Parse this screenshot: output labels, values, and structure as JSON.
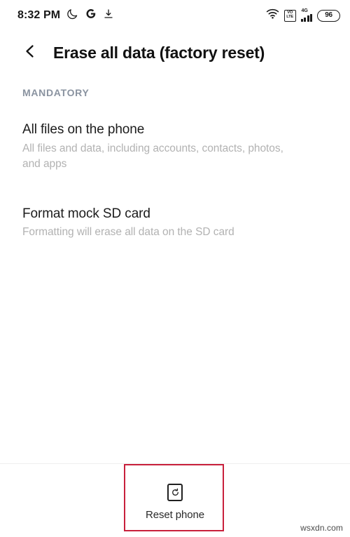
{
  "status_bar": {
    "time": "8:32 PM",
    "icons_left": [
      "moon-icon",
      "google-icon",
      "download-icon"
    ],
    "volte_line1": "VO",
    "volte_line2": "LTE",
    "network_type": "4G",
    "battery_level": "96",
    "icons_right": [
      "wifi-icon",
      "volte-icon",
      "signal-icon",
      "battery-icon"
    ]
  },
  "app_bar": {
    "back_icon": "chevron-left-icon",
    "title": "Erase all data (factory reset)"
  },
  "content": {
    "section_header": "MANDATORY",
    "items": [
      {
        "title": "All files on the phone",
        "subtitle": "All files and data, including accounts, contacts, photos, and apps"
      },
      {
        "title": "Format mock SD card",
        "subtitle": "Formatting will erase all data on the SD card"
      }
    ]
  },
  "bottom_bar": {
    "reset_icon": "reset-phone-icon",
    "reset_label": "Reset phone"
  },
  "annotation": {
    "color": "#c8203c"
  },
  "watermark": {
    "text": "wsxdn.com"
  }
}
